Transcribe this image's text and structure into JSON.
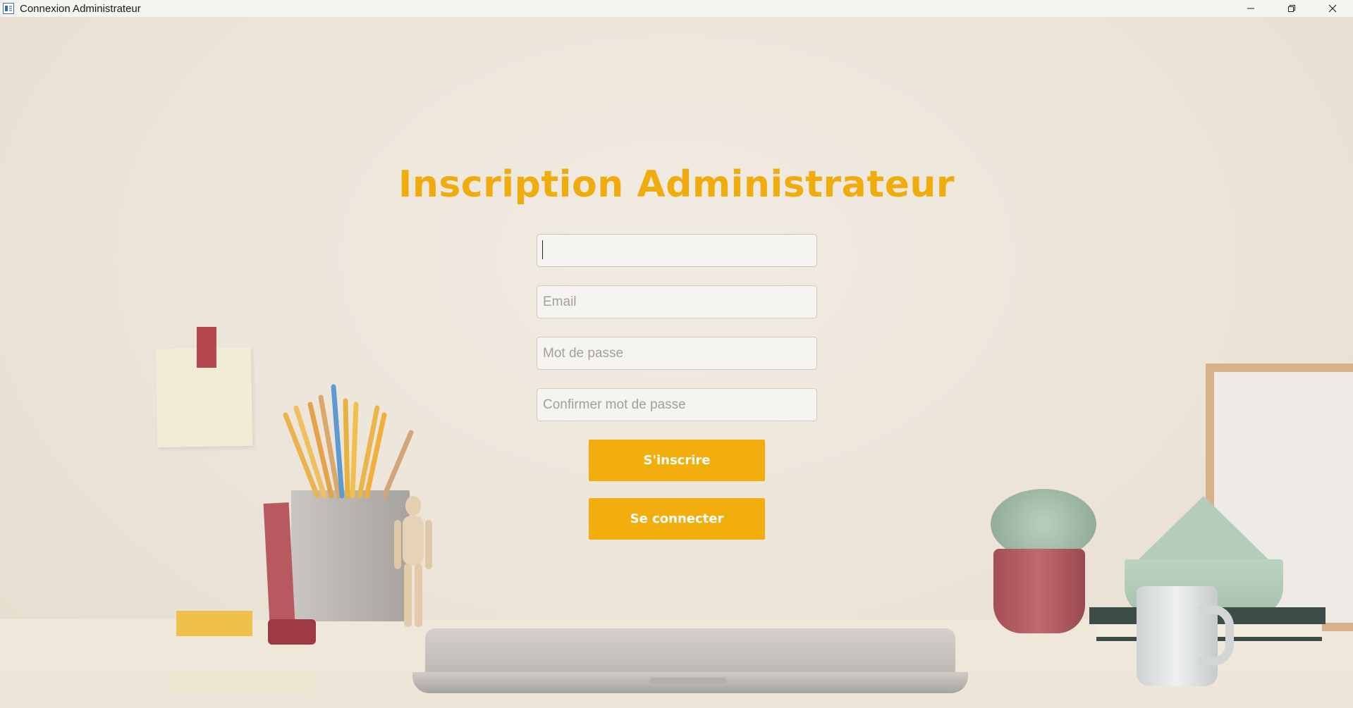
{
  "window": {
    "title": "Connexion Administrateur",
    "controls": {
      "minimize_icon": "minimize-icon",
      "maximize_icon": "restore-icon",
      "close_icon": "close-icon"
    }
  },
  "form": {
    "title": "Inscription Administrateur",
    "fields": {
      "name": {
        "value": "",
        "placeholder": ""
      },
      "email": {
        "value": "",
        "placeholder": "Email"
      },
      "password": {
        "value": "",
        "placeholder": "Mot de passe"
      },
      "confirm_password": {
        "value": "",
        "placeholder": "Confirmer mot de passe"
      }
    },
    "register_label": "S'inscrire",
    "login_label": "Se connecter"
  },
  "colors": {
    "accent": "#f1ae0d",
    "title": "#f0ac0c",
    "button_text": "#ffffff",
    "background": "#ece4d8"
  }
}
